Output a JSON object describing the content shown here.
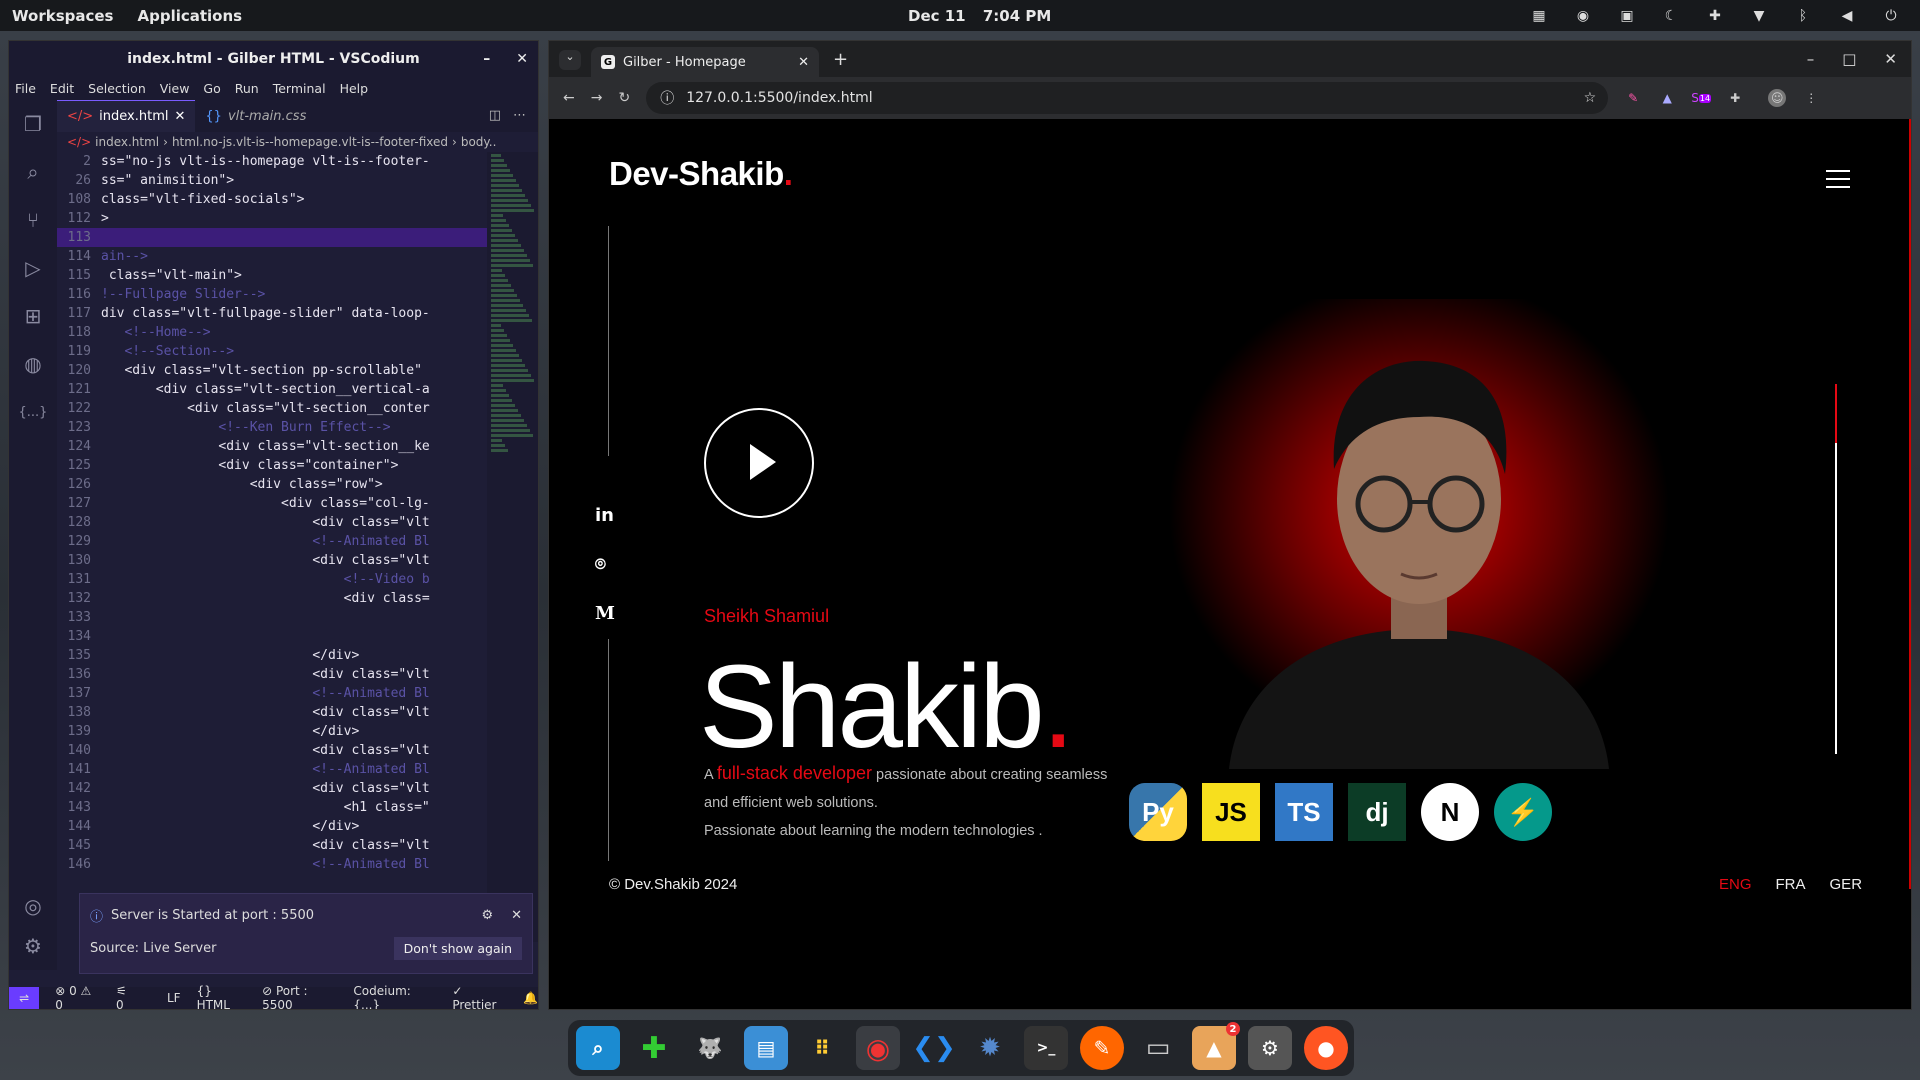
{
  "topbar": {
    "workspaces": "Workspaces",
    "applications": "Applications",
    "date": "Dec 11",
    "time": "7:04 PM"
  },
  "vscode": {
    "title": "index.html - Gilber HTML - VSCodium",
    "menu": [
      "File",
      "Edit",
      "Selection",
      "View",
      "Go",
      "Run",
      "Terminal",
      "Help"
    ],
    "tabs": [
      {
        "label": "index.html",
        "active": true
      },
      {
        "label": "vlt-main.css",
        "active": false
      }
    ],
    "breadcrumb": [
      "index.html",
      "html.no-js.vlt-is--homepage.vlt-is--footer-fixed",
      "body.."
    ],
    "code": [
      {
        "n": "2",
        "t": "ss=\"no-js vlt-is--homepage vlt-is--footer-"
      },
      {
        "n": "26",
        "t": "ss=\" animsition\">"
      },
      {
        "n": "108",
        "t": "class=\"vlt-fixed-socials\">"
      },
      {
        "n": "112",
        "t": ">"
      },
      {
        "n": "113",
        "t": "",
        "hl": true
      },
      {
        "n": "114",
        "t": "ain-->"
      },
      {
        "n": "115",
        "t": " class=\"vlt-main\">"
      },
      {
        "n": "116",
        "t": "!--Fullpage Slider-->"
      },
      {
        "n": "117",
        "t": "div class=\"vlt-fullpage-slider\" data-loop-"
      },
      {
        "n": "118",
        "t": "   <!--Home-->"
      },
      {
        "n": "119",
        "t": "   <!--Section-->"
      },
      {
        "n": "120",
        "t": "   <div class=\"vlt-section pp-scrollable\""
      },
      {
        "n": "121",
        "t": "       <div class=\"vlt-section__vertical-a"
      },
      {
        "n": "122",
        "t": "           <div class=\"vlt-section__conter"
      },
      {
        "n": "123",
        "t": "               <!--Ken Burn Effect-->"
      },
      {
        "n": "124",
        "t": "               <div class=\"vlt-section__ke"
      },
      {
        "n": "125",
        "t": "               <div class=\"container\">"
      },
      {
        "n": "126",
        "t": "                   <div class=\"row\">"
      },
      {
        "n": "127",
        "t": "                       <div class=\"col-lg-"
      },
      {
        "n": "128",
        "t": "                           <div class=\"vlt"
      },
      {
        "n": "129",
        "t": "                           <!--Animated Bl"
      },
      {
        "n": "130",
        "t": "                           <div class=\"vlt"
      },
      {
        "n": "131",
        "t": "                               <!--Video b"
      },
      {
        "n": "132",
        "t": "                               <div class="
      },
      {
        "n": "133",
        "t": ""
      },
      {
        "n": "134",
        "t": ""
      },
      {
        "n": "135",
        "t": "                           </div>"
      },
      {
        "n": "136",
        "t": "                           <div class=\"vlt"
      },
      {
        "n": "137",
        "t": "                           <!--Animated Bl"
      },
      {
        "n": "138",
        "t": "                           <div class=\"vlt"
      },
      {
        "n": "139",
        "t": "                           </div>"
      },
      {
        "n": "140",
        "t": "                           <div class=\"vlt"
      },
      {
        "n": "141",
        "t": "                           <!--Animated Bl"
      },
      {
        "n": "142",
        "t": "                           <div class=\"vlt"
      },
      {
        "n": "143",
        "t": "                               <h1 class=\""
      },
      {
        "n": "144",
        "t": "                           </div>"
      },
      {
        "n": "145",
        "t": "                           <div class=\"vlt"
      },
      {
        "n": "146",
        "t": "                           <!--Animated Bl"
      }
    ],
    "notification": {
      "message": "Server is Started at port : 5500",
      "source": "Source: Live Server",
      "button": "Don't show again"
    },
    "status": {
      "problems": "0 ⚠ 0",
      "ports": "0",
      "eol": "LF",
      "lang": "HTML",
      "port": "Port : 5500",
      "codeium": "Codeium: {...}",
      "prettier": "Prettier"
    }
  },
  "chrome": {
    "tab_title": "Gilber - Homepage",
    "url": "127.0.0.1:5500/index.html",
    "ext_badge": "14"
  },
  "site": {
    "logo": "Dev-Shakib",
    "logo_dot": ".",
    "socials": [
      "in",
      "⌾",
      "M"
    ],
    "kicker": "Sheikh Shamiul",
    "name": "Shakib",
    "name_dot": ".",
    "bio_a": "A ",
    "bio_highlight": "full-stack developer",
    "bio_b": " passionate about creating seamless and efficient web solutions.",
    "bio_c": "Passionate about learning the modern technologies .",
    "copyright": "© Dev.Shakib 2024",
    "langs": [
      "ENG",
      "FRA",
      "GER"
    ],
    "tech": [
      "Py",
      "JS",
      "TS",
      "dj",
      "N",
      "⚡"
    ],
    "slide_progress": 0.16
  },
  "dock": {
    "badge": "2"
  }
}
